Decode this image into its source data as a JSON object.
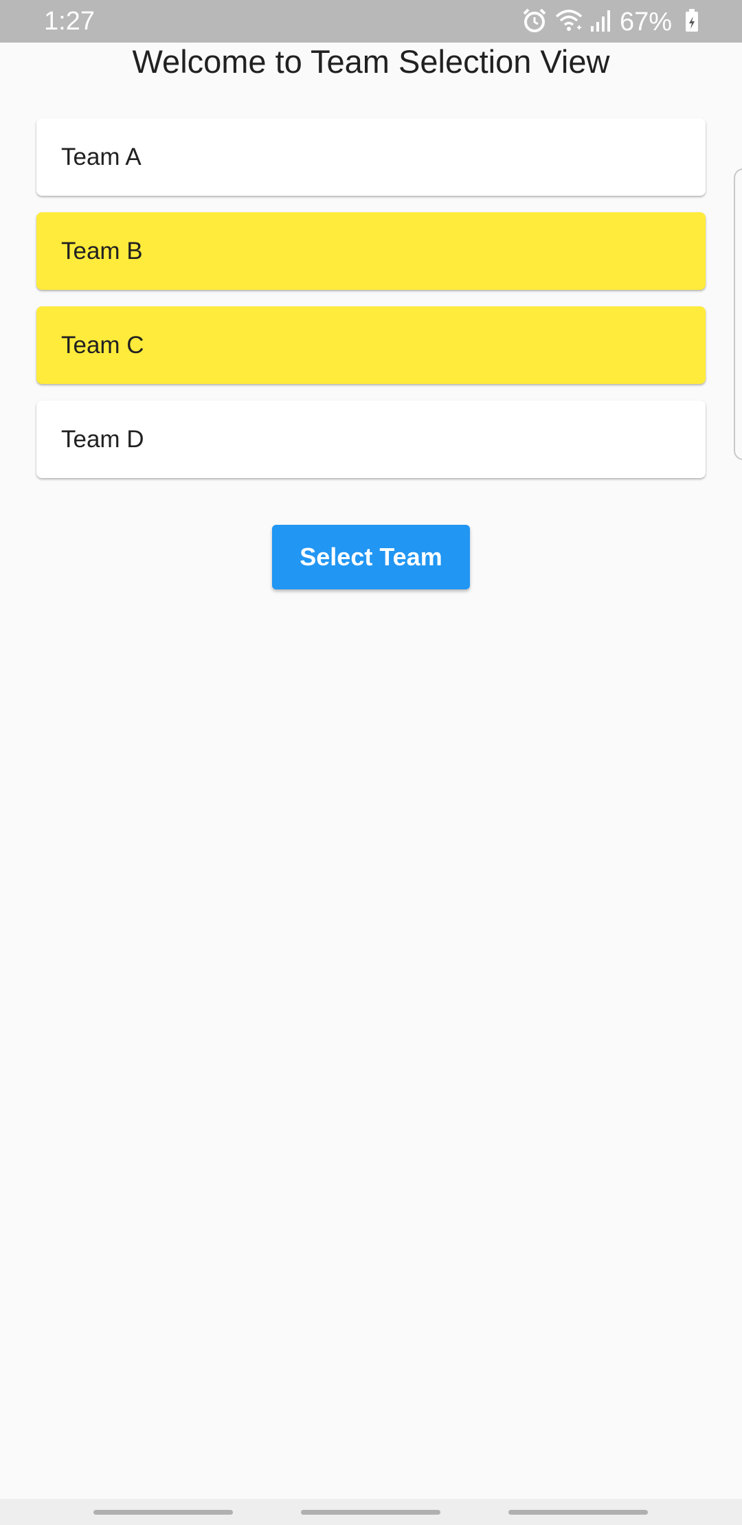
{
  "status_bar": {
    "time": "1:27",
    "battery_percent": "67%",
    "icons": [
      "alarm-icon",
      "wifi-icon",
      "signal-icon",
      "battery-charging-icon"
    ]
  },
  "page": {
    "title": "Welcome to Team Selection View"
  },
  "teams": [
    {
      "label": "Team A",
      "selected": false
    },
    {
      "label": "Team B",
      "selected": true
    },
    {
      "label": "Team C",
      "selected": true
    },
    {
      "label": "Team D",
      "selected": false
    }
  ],
  "actions": {
    "select_label": "Select Team"
  },
  "colors": {
    "accent": "#2196f3",
    "selected": "#ffeb3b",
    "card": "#ffffff",
    "background": "#fafafa",
    "status_bar": "#b8b8b8"
  },
  "nav_bar": {
    "items": [
      "recent-apps-handle",
      "home-handle",
      "back-handle"
    ]
  }
}
